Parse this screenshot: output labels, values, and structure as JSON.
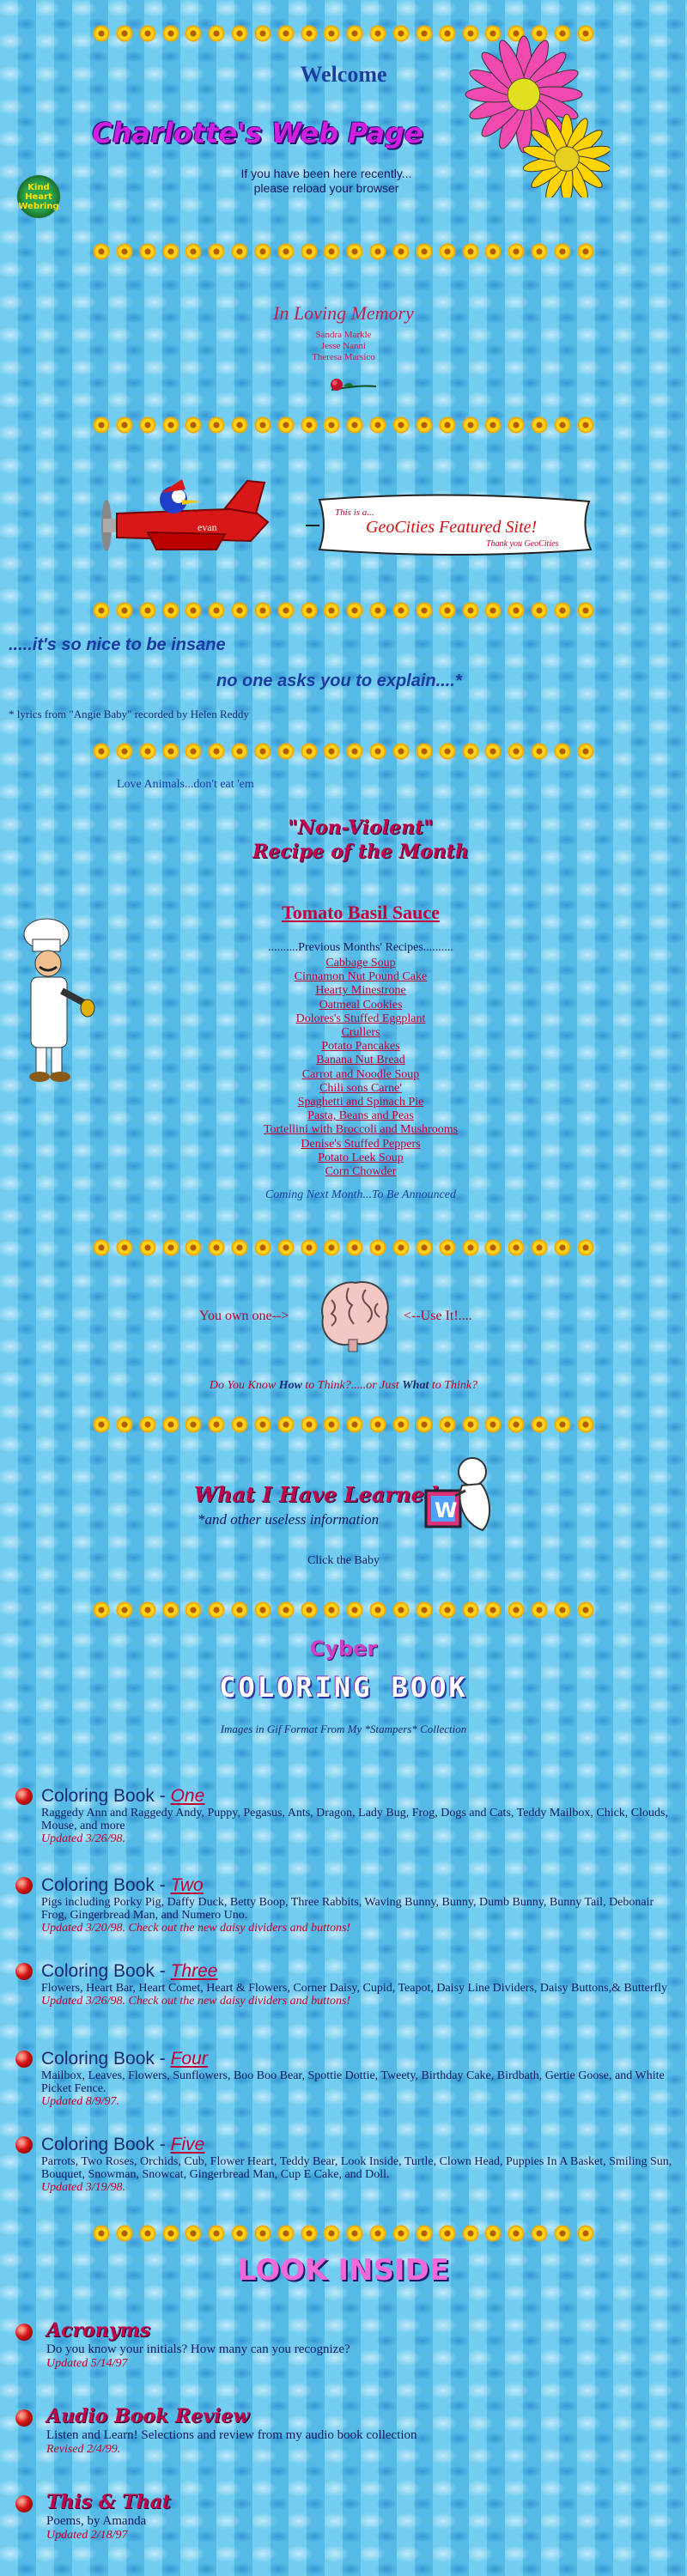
{
  "header": {
    "welcome": "Welcome",
    "title": "Charlotte's Web Page",
    "reload_line1": "If you have been here recently...",
    "reload_line2": "please reload your browser",
    "webring_logo_text": "Kind Heart Webring"
  },
  "memory": {
    "title": "In Loving Memory",
    "names": [
      "Sandra Markle",
      "Jesse Nanni",
      "Theresa Marsico"
    ]
  },
  "banner": {
    "line1": "This is a...",
    "line2": "GeoCities Featured Site!",
    "line3": "Thank you GeoCities"
  },
  "plane": {
    "tail_text": "evan"
  },
  "lyric": {
    "line1": ".....it's so nice to be insane",
    "line2": "no one asks you to explain....*",
    "credit": "* lyrics from \"Angie Baby\" recorded by Helen Reddy"
  },
  "animals": "Love Animals...don't eat 'em",
  "recipes": {
    "heading_line1": "\"Non-Violent\"",
    "heading_line2": "Recipe of the Month",
    "current": "Tomato Basil Sauce",
    "previous_label": "..........Previous Months' Recipes..........",
    "previous": [
      "Cabbage Soup",
      "Cinnamon Nut Pound Cake",
      "Hearty Minestrone",
      "Oatmeal Cookies",
      "Dolores's Stuffed Eggplant",
      "Crullers",
      "Potato Pancakes",
      "Banana Nut Bread",
      "Carrot and Noodle Soup",
      "Chili sons Carne'",
      "Spaghetti and Spinach Pie",
      "Pasta, Beans and Peas",
      "Tortellini with Broccoli and Mushrooms",
      "Denise's Stuffed Peppers",
      "Potato Leek Soup",
      "Corn Chowder"
    ],
    "coming_next": "Coming Next Month...To Be Announced"
  },
  "brain": {
    "left": "You own one-->",
    "right": "<--Use It!....",
    "think_prefix": "Do You Know ",
    "think_how": "How",
    "think_mid": " to Think?.....or Just ",
    "think_what": "What",
    "think_suffix": " to Think?"
  },
  "learned": {
    "title": "What I Have Learned",
    "subtitle": "*and other useless information",
    "click": "Click the Baby",
    "block_letter": "W"
  },
  "coloring": {
    "cyber": "Cyber",
    "title": "COLORING BOOK",
    "note": "Images in Gif Format From My *Stampers* Collection",
    "books": [
      {
        "prefix": "Coloring Book - ",
        "number": "One",
        "desc": "Raggedy Ann and Raggedy Andy, Puppy, Pegasus, Ants, Dragon, Lady Bug, Frog, Dogs and Cats, Teddy Mailbox, Chick, Clouds, Mouse, and more",
        "updated": "Updated 3/26/98."
      },
      {
        "prefix": "Coloring Book - ",
        "number": "Two",
        "desc": "Pigs including Porky Pig, Daffy Duck, Betty Boop, Three Rabbits, Waving Bunny, Bunny, Dumb Bunny, Bunny Tail, Debonair Frog, Gingerbread Man, and Numero Uno.",
        "updated": "Updated 3/20/98. Check out the new daisy dividers and buttons!"
      },
      {
        "prefix": "Coloring Book - ",
        "number": "Three",
        "desc": "Flowers, Heart Bar, Heart Comet, Heart & Flowers, Corner Daisy, Cupid, Teapot, Daisy Line Dividers, Daisy Buttons,& Butterfly",
        "updated": "Updated 3/26/98. Check out the new daisy dividers and buttons!"
      },
      {
        "prefix": "Coloring Book - ",
        "number": "Four",
        "desc": "Mailbox, Leaves, Flowers, Sunflowers, Boo Boo Bear, Spottie Dottie, Tweety, Birthday Cake, Birdbath, Gertie Goose, and White Picket Fence.",
        "updated": "Updated 8/9/97."
      },
      {
        "prefix": "Coloring Book - ",
        "number": "Five",
        "desc": "Parrots, Two Roses, Orchids, Cub, Flower Heart, Teddy Bear, Look Inside, Turtle, Clown Head, Puppies In A Basket, Smiling Sun, Bouquet, Snowman, Snowcat, Gingerbread Man, Cup E Cake, and Doll.",
        "updated": "Updated 3/19/98."
      }
    ]
  },
  "look_inside": {
    "title": "LOOK INSIDE",
    "items": [
      {
        "title": "Acronyms",
        "desc": "Do you know your initials? How many can you recognize?",
        "updated": "Updated 5/14/97"
      },
      {
        "title": "Audio Book Review",
        "desc": "Listen and Learn! Selections and review from my audio book collection",
        "updated": "Revised 2/4/99."
      },
      {
        "title": "This & That",
        "desc": "Poems, by Amanda",
        "updated": "Updated 2/18/97"
      }
    ]
  }
}
